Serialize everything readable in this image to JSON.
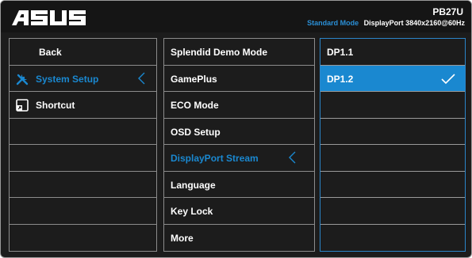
{
  "header": {
    "logo_text": "/SUS",
    "model": "PB27U",
    "mode": "Standard Mode",
    "input_info": "DisplayPort  3840x2160@60Hz"
  },
  "menu_level1": [
    {
      "label": "Back",
      "icon": null
    },
    {
      "label": "System Setup",
      "icon": "wrench-screwdriver-icon",
      "active": true
    },
    {
      "label": "Shortcut",
      "icon": "shortcut-icon"
    },
    {
      "label": ""
    },
    {
      "label": ""
    },
    {
      "label": ""
    },
    {
      "label": ""
    },
    {
      "label": ""
    }
  ],
  "menu_level2": [
    {
      "label": "Splendid Demo Mode"
    },
    {
      "label": "GamePlus"
    },
    {
      "label": "ECO Mode"
    },
    {
      "label": "OSD Setup"
    },
    {
      "label": "DisplayPort Stream",
      "active": true
    },
    {
      "label": "Language"
    },
    {
      "label": "Key Lock"
    },
    {
      "label": "More"
    }
  ],
  "menu_level3": [
    {
      "label": "DP1.1"
    },
    {
      "label": "DP1.2",
      "selected": true
    },
    {
      "label": ""
    },
    {
      "label": ""
    },
    {
      "label": ""
    },
    {
      "label": ""
    },
    {
      "label": ""
    },
    {
      "label": ""
    }
  ],
  "colors": {
    "accent": "#1a88d0",
    "background": "#1c1c1c",
    "border": "#8c8c8c"
  }
}
